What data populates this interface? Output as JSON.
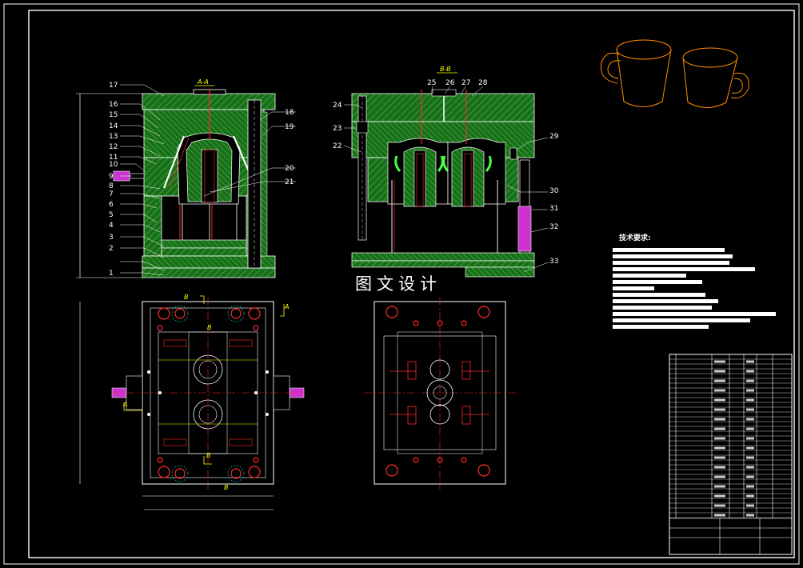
{
  "drawing": {
    "front_section_label": "A-A",
    "side_section_label": "B-B",
    "watermark": "图文设计",
    "tech_req_title": "技术要求:",
    "front_part_numbers": [
      "17",
      "16",
      "15",
      "14",
      "13",
      "12",
      "11",
      "10",
      "9",
      "8",
      "7",
      "6",
      "5",
      "4",
      "3",
      "2",
      "1"
    ],
    "front_right_numbers": [
      "18",
      "19",
      "20",
      "21"
    ],
    "side_top_numbers": [
      "25",
      "26",
      "27",
      "28"
    ],
    "side_left_numbers": [
      "24",
      "23",
      "22"
    ],
    "side_right_numbers": [
      "29",
      "30",
      "31",
      "32",
      "33"
    ],
    "plan_marks": [
      "B",
      "B",
      "A",
      "A",
      "B",
      "B"
    ]
  },
  "colors": {
    "background": "#000000",
    "hatch_green": "#1e7a1e",
    "outline_white": "#ffffff",
    "center_red": "#ff2a2a",
    "dim_yellow": "#ffff00",
    "product_orange": "#ff8c00",
    "heater_magenta": "#cc33cc"
  }
}
